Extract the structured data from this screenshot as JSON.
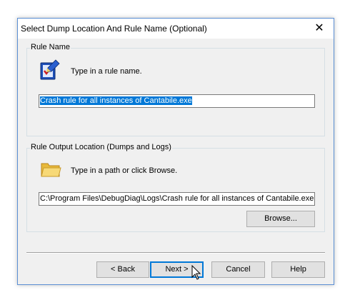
{
  "dialog": {
    "title": "Select Dump Location And Rule Name (Optional)"
  },
  "rule_name_group": {
    "label": "Rule Name",
    "prompt": "Type in a rule name.",
    "icon": "rule-checklist-icon",
    "value": "Crash rule for all instances of Cantabile.exe"
  },
  "output_group": {
    "label": "Rule Output Location (Dumps and Logs)",
    "prompt": "Type in a path or click Browse.",
    "icon": "folder-icon",
    "path": "C:\\Program Files\\DebugDiag\\Logs\\Crash rule for all instances of Cantabile.exe",
    "browse_label": "Browse..."
  },
  "buttons": {
    "back": "< Back",
    "next": "Next >",
    "cancel": "Cancel",
    "help": "Help"
  }
}
